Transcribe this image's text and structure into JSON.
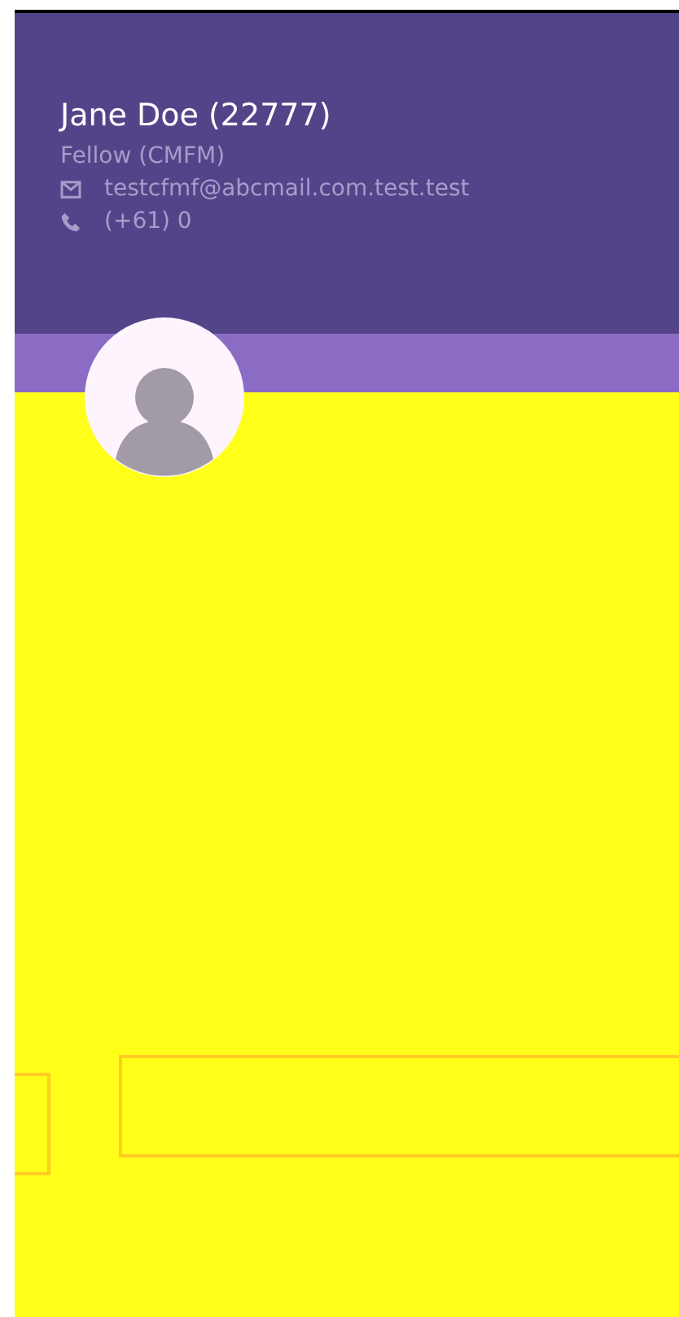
{
  "profile": {
    "name": "Jane Doe (22777)",
    "membership": "Fellow (CMFM)",
    "contacts": [
      {
        "kind": "email",
        "text": "testcfmf@abcmail.com.test.test"
      },
      {
        "kind": "phone",
        "text": "(+61) 0"
      }
    ]
  }
}
